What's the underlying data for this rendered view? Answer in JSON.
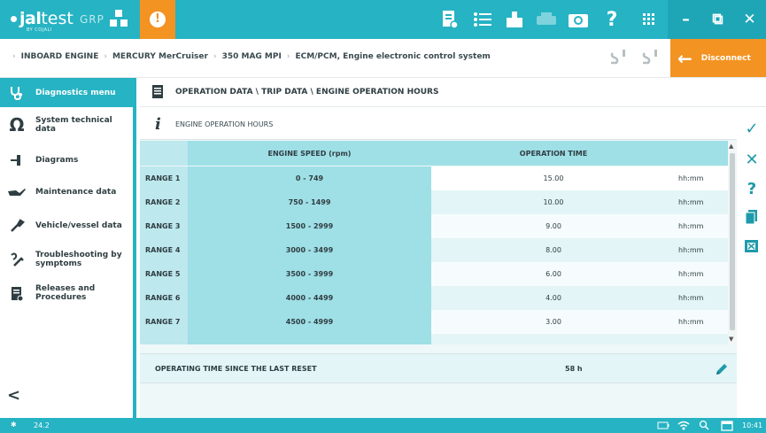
{
  "topbar": {
    "logo_jal": "jal",
    "logo_test": "test",
    "logo_sub": "BY COJALI",
    "group_label": "GRP",
    "alert_symbol": "!",
    "help_symbol": "?",
    "icons": [
      "report-icon",
      "list-icon",
      "clipboard-icon",
      "print-icon",
      "camera-icon",
      "help-icon",
      "grid-icon"
    ],
    "minimize_symbol": "–",
    "restore_symbol": "⧉",
    "close_symbol": "✕"
  },
  "breadcrumb": {
    "items": [
      "INBOARD ENGINE",
      "MERCURY MerCruiser",
      "350 MAG MPI",
      "ECM/PCM, Engine electronic control system"
    ],
    "disconnect_label": "Disconnect",
    "disconnect_arrow": "←"
  },
  "sidebar": {
    "items": [
      {
        "label": "Diagnostics menu",
        "icon": "stethoscope-icon"
      },
      {
        "label": "System technical data",
        "icon": "omega-icon"
      },
      {
        "label": "Diagrams",
        "icon": "diagram-icon"
      },
      {
        "label": "Maintenance data",
        "icon": "oil-can-icon"
      },
      {
        "label": "Vehicle/vessel data",
        "icon": "wrench-icon"
      },
      {
        "label": "Troubleshooting by symptoms",
        "icon": "troubleshoot-icon"
      },
      {
        "label": "Releases and Procedures",
        "icon": "procedures-icon"
      }
    ],
    "back_symbol": "<"
  },
  "main": {
    "title": "OPERATION DATA \\ TRIP DATA \\ ENGINE OPERATION HOURS",
    "panel_info_symbol": "i",
    "panel_title": "ENGINE OPERATION HOURS",
    "columns": {
      "speed": "ENGINE SPEED (rpm)",
      "time": "OPERATION TIME"
    },
    "rows": [
      {
        "name": "RANGE 1",
        "speed": "0 - 749",
        "time": "15.00",
        "unit": "hh:mm"
      },
      {
        "name": "RANGE 2",
        "speed": "750 - 1499",
        "time": "10.00",
        "unit": "hh:mm"
      },
      {
        "name": "RANGE 3",
        "speed": "1500 - 2999",
        "time": "9.00",
        "unit": "hh:mm"
      },
      {
        "name": "RANGE 4",
        "speed": "3000 - 3499",
        "time": "8.00",
        "unit": "hh:mm"
      },
      {
        "name": "RANGE 5",
        "speed": "3500 - 3999",
        "time": "6.00",
        "unit": "hh:mm"
      },
      {
        "name": "RANGE 6",
        "speed": "4000 - 4499",
        "time": "4.00",
        "unit": "hh:mm"
      },
      {
        "name": "RANGE 7",
        "speed": "4500 - 4999",
        "time": "3.00",
        "unit": "hh:mm"
      }
    ],
    "footer": {
      "label": "OPERATING TIME SINCE THE LAST RESET",
      "value": "58 h"
    }
  },
  "tools": {
    "check_symbol": "✓",
    "close_symbol": "✕",
    "help_symbol": "?"
  },
  "statusbar": {
    "version": "24.2",
    "bluetooth_symbol": "✱",
    "time": "10:41"
  },
  "colors": {
    "accent": "#26b3c3",
    "orange": "#f39322",
    "header_cell": "#9fdfe6",
    "name_cell": "#bde8ed"
  }
}
